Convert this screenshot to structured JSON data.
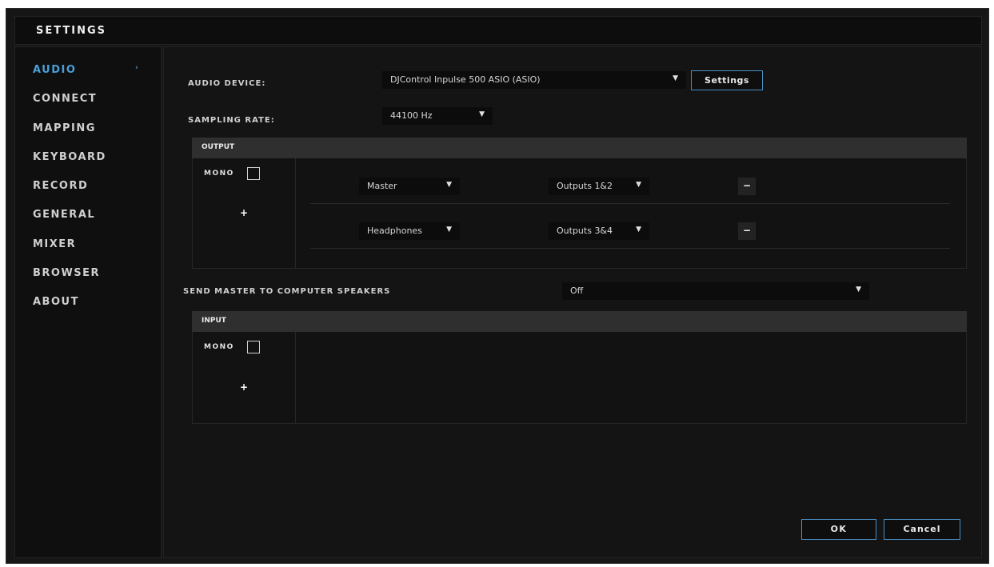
{
  "window": {
    "title": "SETTINGS"
  },
  "sidebar": {
    "items": [
      {
        "label": "AUDIO",
        "active": true
      },
      {
        "label": "CONNECT"
      },
      {
        "label": "MAPPING"
      },
      {
        "label": "KEYBOARD"
      },
      {
        "label": "RECORD"
      },
      {
        "label": "GENERAL"
      },
      {
        "label": "MIXER"
      },
      {
        "label": "BROWSER"
      },
      {
        "label": "ABOUT"
      }
    ],
    "active_chevron": "›"
  },
  "audio": {
    "device_label": "AUDIO DEVICE:",
    "device_value": "DJControl Inpulse 500 ASIO (ASIO)",
    "settings_button": "Settings",
    "sampling_label": "SAMPLING RATE:",
    "sampling_value": "44100 Hz",
    "output": {
      "header": "OUTPUT",
      "mono_label": "MONO",
      "plus": "+",
      "rows": [
        {
          "channel": "Master",
          "outputs": "Outputs 1&2",
          "remove": "−"
        },
        {
          "channel": "Headphones",
          "outputs": "Outputs 3&4",
          "remove": "−"
        }
      ]
    },
    "send_master_label": "SEND MASTER TO COMPUTER SPEAKERS",
    "send_master_value": "Off",
    "input": {
      "header": "INPUT",
      "mono_label": "MONO",
      "plus": "+"
    }
  },
  "footer": {
    "ok": "OK",
    "cancel": "Cancel"
  },
  "icons": {
    "dropdown_arrow": "▼"
  },
  "colors": {
    "accent": "#4a9fd8",
    "button_border": "#4a8fc4",
    "background": "#141414"
  }
}
